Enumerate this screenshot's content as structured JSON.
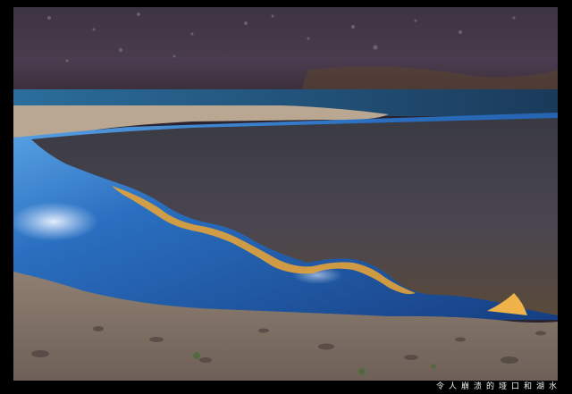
{
  "photo": {
    "caption": "令人崩溃的垭口和湖水",
    "palette": {
      "frame": "#000000",
      "mountain_dark": "#2e2633",
      "mountain_mid": "#4a3d52",
      "water_blue": "#1f5fa8",
      "water_deep": "#12356e",
      "reflection_gold": "#e09a2a",
      "shore_sand": "#9c8b78",
      "gravel": "#7a6c63"
    }
  }
}
